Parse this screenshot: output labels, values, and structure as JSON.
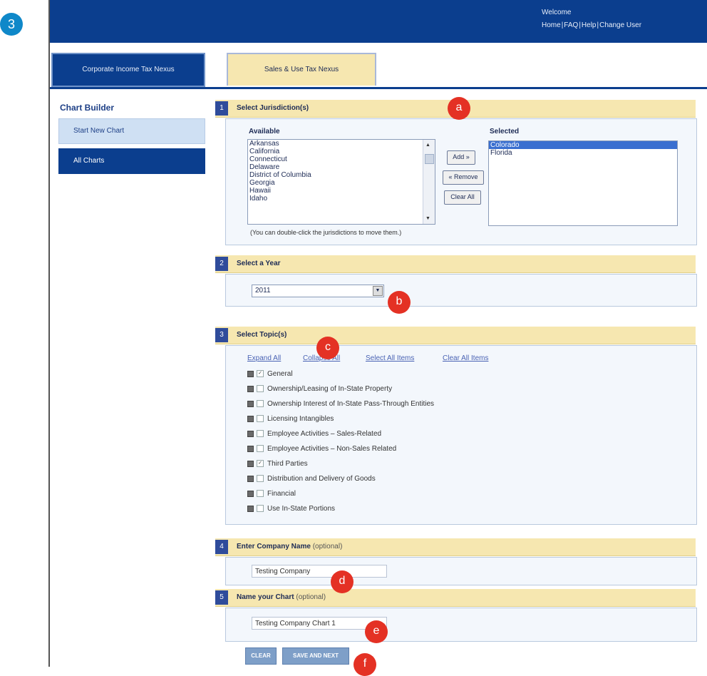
{
  "step_badge": "3",
  "header": {
    "welcome": "Welcome",
    "links": [
      "Home",
      "FAQ",
      "Help",
      "Change User"
    ]
  },
  "tabs": [
    {
      "label": "Corporate Income Tax Nexus"
    },
    {
      "label": "Sales & Use Tax Nexus"
    }
  ],
  "sidebar": {
    "title": "Chart Builder",
    "items": [
      {
        "label": "Start New Chart"
      },
      {
        "label": "All Charts"
      }
    ]
  },
  "section1": {
    "num": "1",
    "title": "Select Jurisdiction(s)",
    "available_label": "Available",
    "selected_label": "Selected",
    "available": [
      "Arkansas",
      "California",
      "Connecticut",
      "Delaware",
      "District of Columbia",
      "Georgia",
      "Hawaii",
      "Idaho"
    ],
    "selected": [
      "Colorado",
      "Florida"
    ],
    "add_label": "Add »",
    "remove_label": "« Remove",
    "clear_label": "Clear All",
    "note": "(You can double-click the jurisdictions to move them.)"
  },
  "section2": {
    "num": "2",
    "title": "Select a Year",
    "year": "2011"
  },
  "section3": {
    "num": "3",
    "title": "Select Topic(s)",
    "links": [
      "Expand All",
      "Collapse All",
      "Select All Items",
      "Clear All Items"
    ],
    "topics": [
      {
        "label": "General",
        "checked": true
      },
      {
        "label": "Ownership/Leasing of In-State Property",
        "checked": false
      },
      {
        "label": "Ownership Interest of In-State Pass-Through Entities",
        "checked": false
      },
      {
        "label": "Licensing Intangibles",
        "checked": false
      },
      {
        "label": "Employee Activities – Sales-Related",
        "checked": false
      },
      {
        "label": "Employee Activities – Non-Sales Related",
        "checked": false
      },
      {
        "label": "Third Parties",
        "checked": true
      },
      {
        "label": "Distribution and Delivery of Goods",
        "checked": false
      },
      {
        "label": "Financial",
        "checked": false
      },
      {
        "label": "Use In-State Portions",
        "checked": false
      }
    ]
  },
  "section4": {
    "num": "4",
    "title": "Enter Company Name",
    "optional": "(optional)",
    "value": "Testing Company"
  },
  "section5": {
    "num": "5",
    "title": "Name your Chart",
    "optional": "(optional)",
    "value": "Testing Company Chart 1"
  },
  "actions": {
    "clear": "CLEAR",
    "save_next": "SAVE AND NEXT"
  },
  "markers": [
    "a",
    "b",
    "c",
    "d",
    "e",
    "f"
  ],
  "colors": {
    "header_blue": "#0b3e8e",
    "section_header": "#f6e7b0",
    "marker_red": "#e43124",
    "badge_blue": "#0f88c9"
  }
}
